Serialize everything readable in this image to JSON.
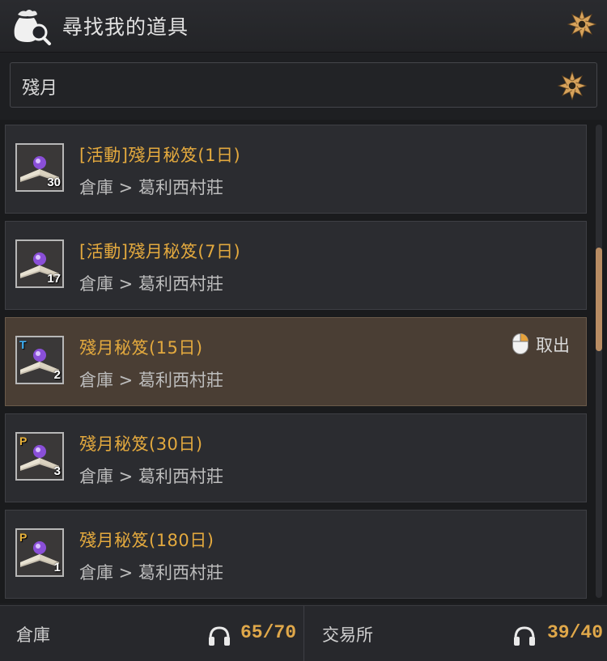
{
  "header": {
    "title": "尋找我的道具",
    "icon": "money-bag-search-icon",
    "settings_icon": "gold-flower-icon"
  },
  "search": {
    "value": "殘月",
    "icon": "gold-flower-icon"
  },
  "items": [
    {
      "name": "[活動]殘月秘笈(1日)",
      "location": "倉庫 > 葛利西村莊",
      "count": "30",
      "tag": "",
      "selected": false
    },
    {
      "name": "[活動]殘月秘笈(7日)",
      "location": "倉庫 > 葛利西村莊",
      "count": "17",
      "tag": "",
      "selected": false
    },
    {
      "name": "殘月秘笈(15日)",
      "location": "倉庫 > 葛利西村莊",
      "count": "2",
      "tag": "T",
      "selected": true,
      "action_label": "取出"
    },
    {
      "name": "殘月秘笈(30日)",
      "location": "倉庫 > 葛利西村莊",
      "count": "3",
      "tag": "P",
      "selected": false
    },
    {
      "name": "殘月秘笈(180日)",
      "location": "倉庫 > 葛利西村莊",
      "count": "1",
      "tag": "P",
      "selected": false
    }
  ],
  "footer": {
    "warehouse": {
      "label": "倉庫",
      "count": "65/70"
    },
    "exchange": {
      "label": "交易所",
      "count": "39/40"
    }
  },
  "colors": {
    "accent": "#e3a93e",
    "selected_bg": "#4a3e34",
    "scroll_thumb": "#b88c63"
  }
}
